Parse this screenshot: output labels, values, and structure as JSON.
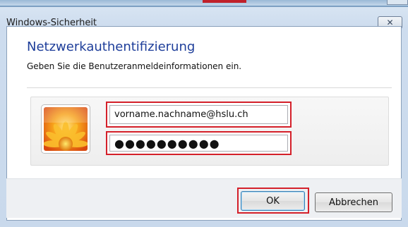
{
  "window": {
    "title": "Windows-Sicherheit",
    "close_glyph": "✕"
  },
  "dialog": {
    "heading": "Netzwerkauthentifizierung",
    "subtext": "Geben Sie die Benutzeranmeldeinformationen ein."
  },
  "credentials": {
    "username_value": "vorname.nachname@hslu.ch",
    "password_value": "●●●●●●●●●●",
    "avatar_icon": "flower-user-tile-icon"
  },
  "buttons": {
    "ok_label": "OK",
    "cancel_label": "Abbrechen"
  },
  "colors": {
    "heading": "#1e3e9a",
    "highlight": "#d4202a"
  }
}
